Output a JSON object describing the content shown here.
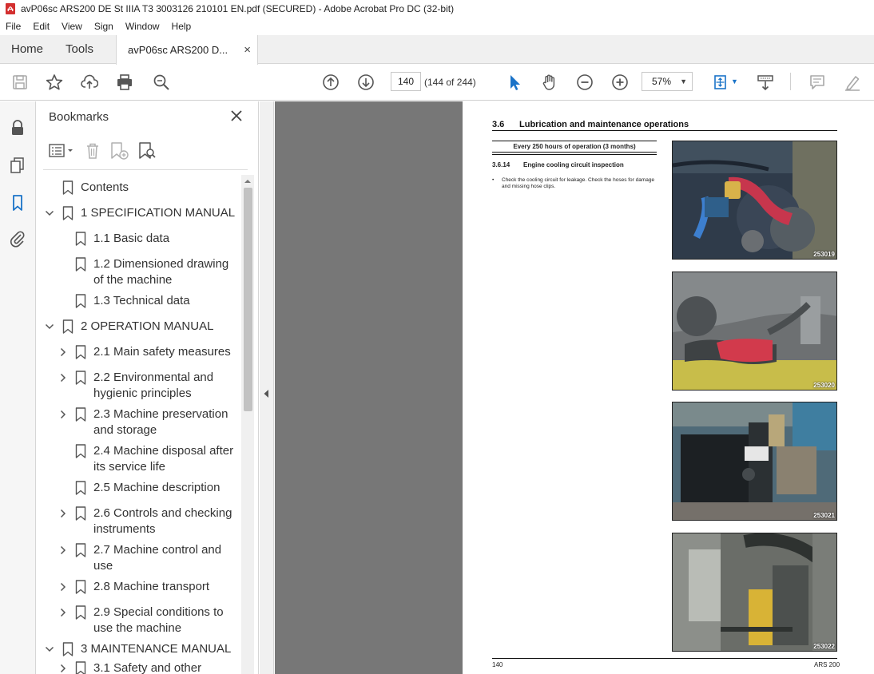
{
  "window": {
    "title": "avP06sc ARS200 DE St IIIA T3 3003126 210101 EN.pdf (SECURED) - Adobe Acrobat Pro DC (32-bit)"
  },
  "menu": [
    "File",
    "Edit",
    "View",
    "Sign",
    "Window",
    "Help"
  ],
  "tabs": {
    "home": "Home",
    "tools": "Tools",
    "doc": "avP06sc ARS200 D...",
    "close": "×"
  },
  "toolbar": {
    "page_value": "140",
    "page_count": "(144 of 244)",
    "zoom": "57%"
  },
  "bookmarks": {
    "title": "Bookmarks",
    "items": [
      {
        "label": "Contents"
      },
      {
        "label": "1 SPECIFICATION MANUAL"
      },
      {
        "label": "1.1 Basic data"
      },
      {
        "label": "1.2 Dimensioned drawing of the machine"
      },
      {
        "label": "1.3 Technical data"
      },
      {
        "label": "2 OPERATION MANUAL"
      },
      {
        "label": "2.1 Main safety measures"
      },
      {
        "label": "2.2 Environmental and hygienic principles"
      },
      {
        "label": "2.3 Machine preservation and storage"
      },
      {
        "label": "2.4 Machine disposal after its service life"
      },
      {
        "label": "2.5 Machine description"
      },
      {
        "label": "2.6 Controls and checking instruments"
      },
      {
        "label": "2.7 Machine control and use"
      },
      {
        "label": "2.8 Machine transport"
      },
      {
        "label": "2.9 Special conditions to use the machine"
      },
      {
        "label": "3 MAINTENANCE MANUAL"
      },
      {
        "label": "3.1 Safety and other"
      }
    ]
  },
  "page": {
    "section_num": "3.6",
    "section_title": "Lubrication and maintenance operations",
    "interval": "Every 250 hours of operation (3 months)",
    "sub_num": "3.6.14",
    "sub_title": "Engine cooling circuit inspection",
    "bullet": "Check the cooling circuit for leakage. Check the hoses for damage and missing hose clips.",
    "photos": [
      "253019",
      "253020",
      "253021",
      "253022"
    ],
    "footer_left": "140",
    "footer_right": "ARS 200"
  }
}
